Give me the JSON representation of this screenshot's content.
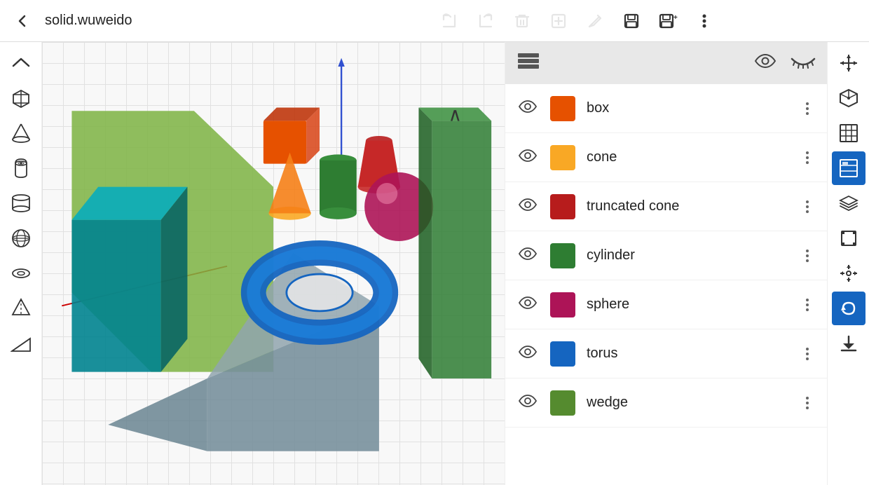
{
  "app": {
    "title": "solid.wuweido"
  },
  "toolbar": {
    "back_label": "←",
    "undo_label": "←",
    "redo_label": "→",
    "delete_label": "🗑",
    "add_label": "+",
    "edit_label": "✏",
    "save_label": "💾",
    "save_as_label": "💾+",
    "more_label": "⋮"
  },
  "left_sidebar": {
    "items": [
      {
        "name": "collapse-icon",
        "icon": "∧",
        "label": "Collapse"
      },
      {
        "name": "box-icon",
        "icon": "⬜",
        "label": "Box"
      },
      {
        "name": "triangle-icon",
        "icon": "△",
        "label": "Triangle"
      },
      {
        "name": "bucket-icon",
        "icon": "🪣",
        "label": "Bucket"
      },
      {
        "name": "cylinder-icon",
        "icon": "⊙",
        "label": "Cylinder"
      },
      {
        "name": "globe-icon",
        "icon": "🌐",
        "label": "Globe"
      },
      {
        "name": "torus-icon",
        "icon": "⊗",
        "label": "Torus"
      },
      {
        "name": "pyramid-icon",
        "icon": "◇",
        "label": "Pyramid"
      },
      {
        "name": "wedge-icon",
        "icon": "◁",
        "label": "Wedge"
      }
    ]
  },
  "panel": {
    "header_icon": "≡",
    "eye_open": "👁",
    "eye_closed": "≡"
  },
  "layers": [
    {
      "id": "box",
      "name": "box",
      "color": "#E65100",
      "visible": true
    },
    {
      "id": "cone",
      "name": "cone",
      "color": "#F9A825",
      "visible": true
    },
    {
      "id": "truncated_cone",
      "name": "truncated cone",
      "color": "#B71C1C",
      "visible": true
    },
    {
      "id": "cylinder",
      "name": "cylinder",
      "color": "#2E7D32",
      "visible": true
    },
    {
      "id": "sphere",
      "name": "sphere",
      "color": "#AD1457",
      "visible": true
    },
    {
      "id": "torus",
      "name": "torus",
      "color": "#1565C0",
      "visible": true
    },
    {
      "id": "wedge",
      "name": "wedge",
      "color": "#558B2F",
      "visible": true
    }
  ],
  "right_sidebar": {
    "items": [
      {
        "name": "transform-icon",
        "icon": "⊹",
        "label": "Transform",
        "active": false
      },
      {
        "name": "view-icon",
        "icon": "⬡",
        "label": "View",
        "active": false
      },
      {
        "name": "grid-icon",
        "icon": "⊞",
        "label": "Grid",
        "active": false
      },
      {
        "name": "layers-icon",
        "icon": "≡",
        "label": "Layers",
        "active": true
      },
      {
        "name": "stack-icon",
        "icon": "◧",
        "label": "Stack",
        "active": false
      },
      {
        "name": "frame-icon",
        "icon": "⬜",
        "label": "Frame",
        "active": false
      },
      {
        "name": "move-icon",
        "icon": "✛",
        "label": "Move",
        "active": false
      },
      {
        "name": "undo-icon",
        "icon": "↺",
        "label": "Undo",
        "active": true
      },
      {
        "name": "import-icon",
        "icon": "⬇",
        "label": "Import",
        "active": false
      }
    ]
  }
}
